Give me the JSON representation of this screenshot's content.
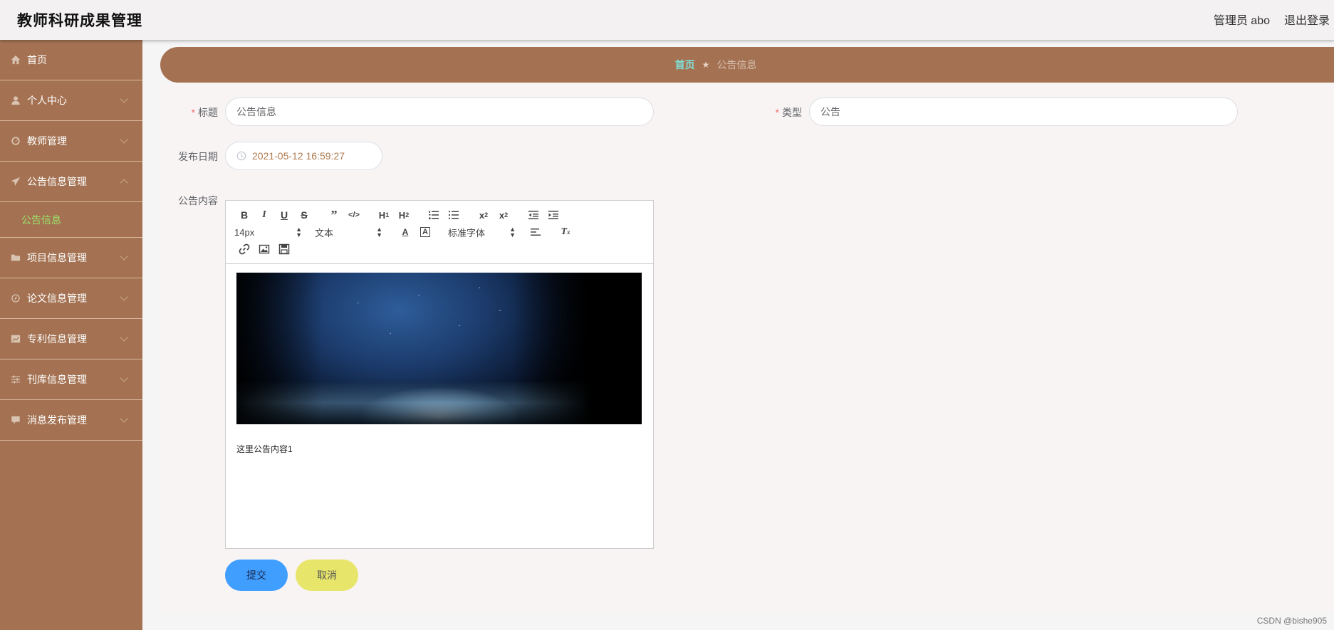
{
  "header": {
    "app_title": "教师科研成果管理",
    "admin_label": "管理员 abo",
    "logout_label": "退出登录"
  },
  "sidebar": {
    "items": [
      {
        "label": "首页",
        "icon": "home-icon",
        "expandable": false
      },
      {
        "label": "个人中心",
        "icon": "user-icon",
        "expandable": true
      },
      {
        "label": "教师管理",
        "icon": "gauge-icon",
        "expandable": true
      },
      {
        "label": "公告信息管理",
        "icon": "send-icon",
        "expandable": true,
        "expanded": true,
        "children": [
          {
            "label": "公告信息"
          }
        ]
      },
      {
        "label": "项目信息管理",
        "icon": "folder-icon",
        "expandable": true
      },
      {
        "label": "论文信息管理",
        "icon": "compass-icon",
        "expandable": true
      },
      {
        "label": "专利信息管理",
        "icon": "chart-icon",
        "expandable": true
      },
      {
        "label": "刊库信息管理",
        "icon": "sliders-icon",
        "expandable": true
      },
      {
        "label": "消息发布管理",
        "icon": "message-icon",
        "expandable": true
      }
    ],
    "bg_color": "#a47252",
    "active_sub_color": "#9be36b"
  },
  "breadcrumb": {
    "home": "首页",
    "current": "公告信息"
  },
  "form": {
    "title_label": "标题",
    "title_value": "公告信息",
    "type_label": "类型",
    "type_value": "公告",
    "date_label": "发布日期",
    "date_value": "2021-05-12 16:59:27",
    "content_label": "公告内容",
    "editor": {
      "font_size": "14px",
      "format": "文本",
      "font_family": "标准字体",
      "content_text": "这里公告内容1"
    },
    "submit_label": "提交",
    "cancel_label": "取消"
  },
  "watermark": "CSDN @bishe905"
}
